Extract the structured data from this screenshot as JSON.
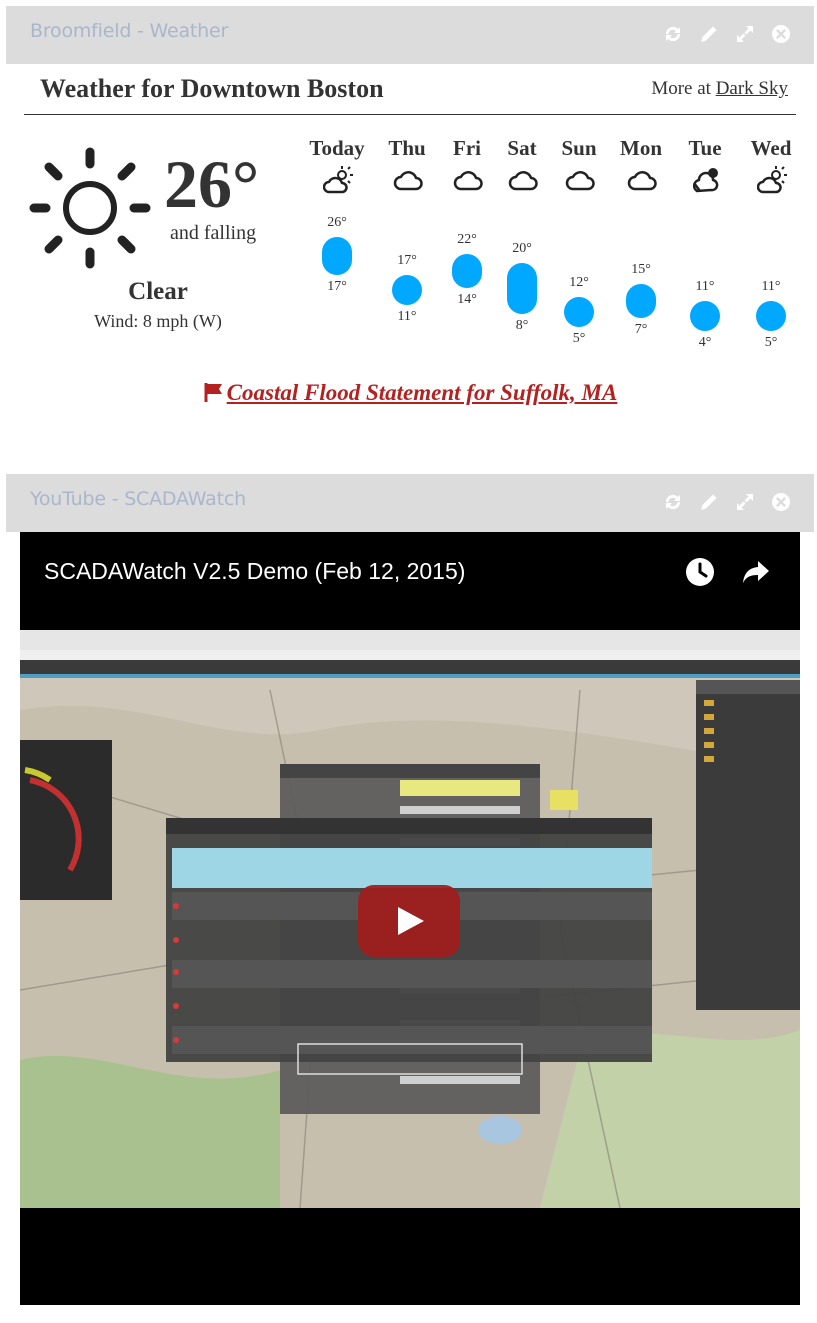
{
  "weather_widget": {
    "title": "Broomfield - Weather",
    "heading": "Weather for Downtown Boston",
    "more_prefix": "More at",
    "more_link": "Dark Sky",
    "current": {
      "icon": "sun-icon",
      "temperature": "26°",
      "trend": "and falling",
      "summary": "Clear",
      "wind": "Wind: 8 mph (W)"
    },
    "forecast": [
      {
        "day": "Today",
        "icon": "partly-cloudy-icon",
        "high": "26°",
        "low": "17°",
        "high_value": 26,
        "low_value": 17
      },
      {
        "day": "Thu",
        "icon": "cloud-icon",
        "high": "17°",
        "low": "11°",
        "high_value": 17,
        "low_value": 11
      },
      {
        "day": "Fri",
        "icon": "cloud-icon",
        "high": "22°",
        "low": "14°",
        "high_value": 22,
        "low_value": 14
      },
      {
        "day": "Sat",
        "icon": "cloud-icon",
        "high": "20°",
        "low": "8°",
        "high_value": 20,
        "low_value": 8
      },
      {
        "day": "Sun",
        "icon": "cloud-icon",
        "high": "12°",
        "low": "5°",
        "high_value": 12,
        "low_value": 5
      },
      {
        "day": "Mon",
        "icon": "cloud-icon",
        "high": "15°",
        "low": "7°",
        "high_value": 15,
        "low_value": 7
      },
      {
        "day": "Tue",
        "icon": "wind-cloud-icon",
        "high": "11°",
        "low": "4°",
        "high_value": 11,
        "low_value": 4
      },
      {
        "day": "Wed",
        "icon": "partly-cloudy-icon",
        "high": "11°",
        "low": "5°",
        "high_value": 11,
        "low_value": 5
      }
    ],
    "alert": "Coastal Flood Statement for Suffolk, MA",
    "colors": {
      "bar": "#00a8ff",
      "alert": "#b42121"
    }
  },
  "youtube_widget": {
    "title": "YouTube - SCADAWatch",
    "video_title": "SCADAWatch V2.5 Demo (Feb 12, 2015)",
    "colors": {
      "play_button": "#a01c1c"
    }
  },
  "toolbar_icons": [
    "refresh-icon",
    "pencil-icon",
    "expand-icon",
    "close-icon"
  ]
}
